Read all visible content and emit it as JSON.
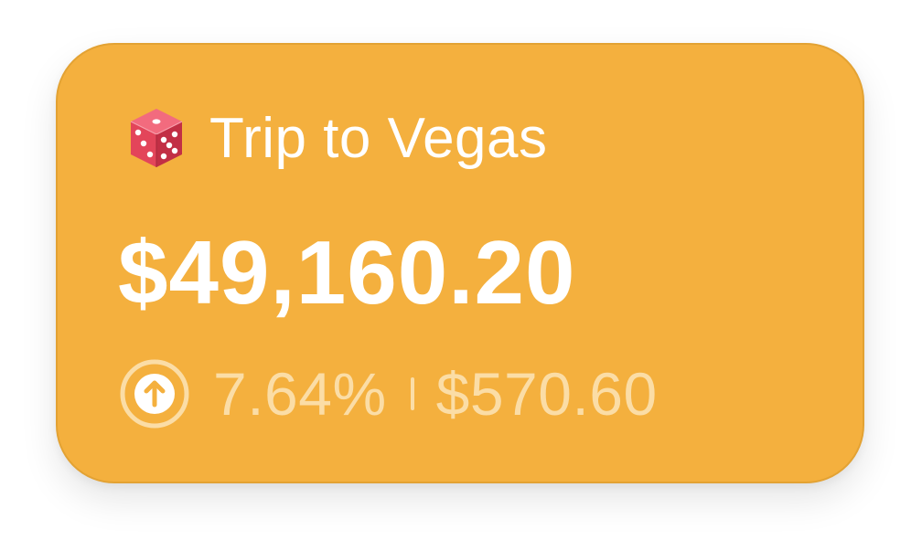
{
  "card": {
    "title": "Trip to Vegas",
    "title_icon": "dice-icon",
    "balance": "$49,160.20",
    "change": {
      "direction_icon": "up-arrow-circle-icon",
      "percent": "7.64%",
      "amount": "$570.60"
    }
  },
  "colors": {
    "card_background": "#F4B03E",
    "primary_text": "#FFFFFF",
    "secondary_text": "#FBDDA6",
    "dice_red": "#E8455A"
  }
}
